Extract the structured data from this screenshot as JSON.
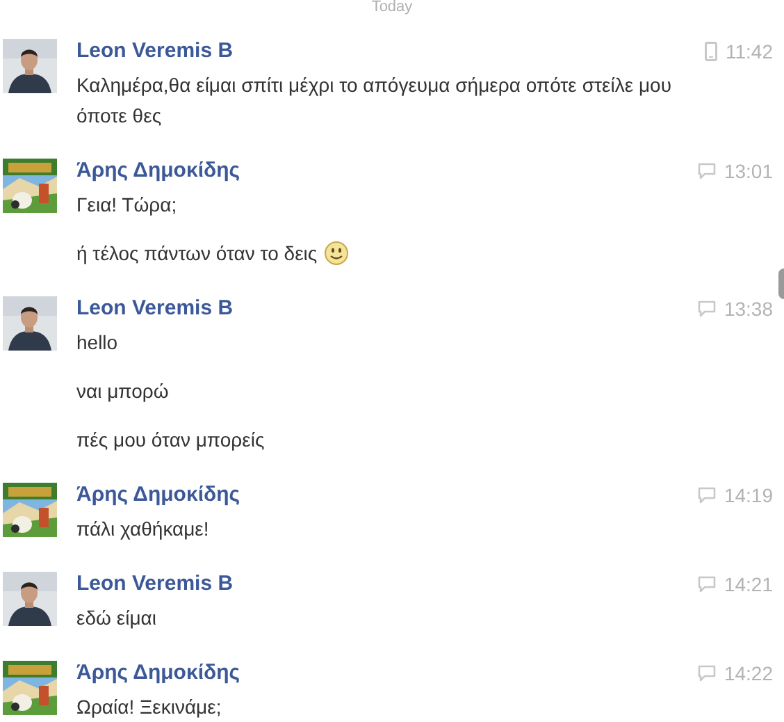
{
  "date_divider": "Today",
  "groups": [
    {
      "sender": "Leon Veremis B",
      "avatar": {
        "kind": "person"
      },
      "time": "11:42",
      "source_icon": {
        "kind": "mobile"
      },
      "messages": [
        {
          "text": "Καλημέρα,θα είμαι σπίτι μέχρι το απόγευμα σήμερα οπότε στείλε μου όποτε θες",
          "emoji": false
        }
      ]
    },
    {
      "sender": "Άρης Δημοκίδης",
      "avatar": {
        "kind": "cartoon"
      },
      "time": "13:01",
      "source_icon": {
        "kind": "chat"
      },
      "messages": [
        {
          "text": "Γεια! Τώρα;",
          "emoji": false
        },
        {
          "text": "ή τέλος πάντων όταν το δεις",
          "emoji": true
        }
      ]
    },
    {
      "sender": "Leon Veremis B",
      "avatar": {
        "kind": "person"
      },
      "time": "13:38",
      "source_icon": {
        "kind": "chat"
      },
      "messages": [
        {
          "text": "hello",
          "emoji": false
        },
        {
          "text": "ναι μπορώ",
          "emoji": false
        },
        {
          "text": "πές μου όταν μπορείς",
          "emoji": false
        }
      ]
    },
    {
      "sender": "Άρης Δημοκίδης",
      "avatar": {
        "kind": "cartoon"
      },
      "time": "14:19",
      "source_icon": {
        "kind": "chat"
      },
      "messages": [
        {
          "text": "πάλι χαθήκαμε!",
          "emoji": false
        }
      ]
    },
    {
      "sender": "Leon Veremis B",
      "avatar": {
        "kind": "person"
      },
      "time": "14:21",
      "source_icon": {
        "kind": "chat"
      },
      "messages": [
        {
          "text": "εδώ είμαι",
          "emoji": false
        }
      ]
    },
    {
      "sender": "Άρης Δημοκίδης",
      "avatar": {
        "kind": "cartoon"
      },
      "time": "14:22",
      "source_icon": {
        "kind": "chat"
      },
      "messages": [
        {
          "text": "Ωραία! Ξεκινάμε;",
          "emoji": false
        }
      ]
    }
  ]
}
